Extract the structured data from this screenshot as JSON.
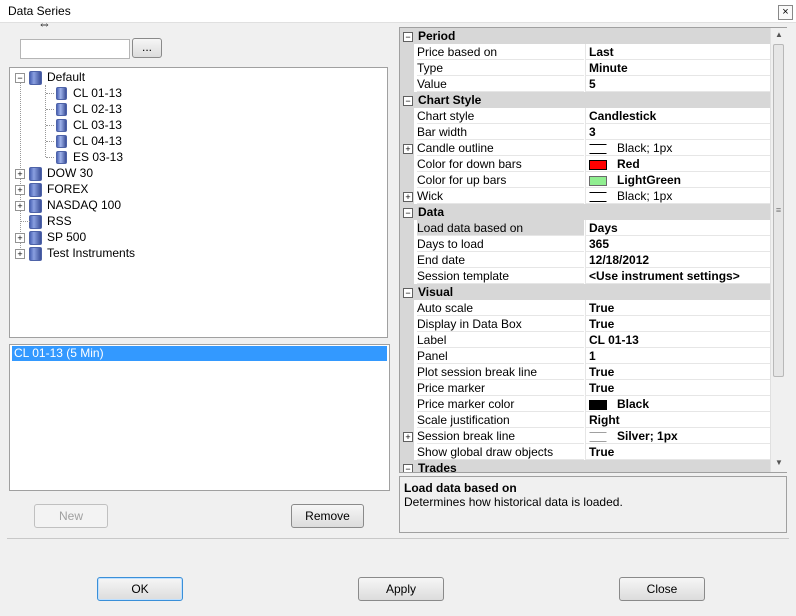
{
  "window": {
    "title": "Data Series",
    "close_glyph": "×"
  },
  "instrument_search": {
    "value": "",
    "browse_label": "..."
  },
  "tree": [
    {
      "label": "Default",
      "expander": "−"
    },
    {
      "label": "CL 01-13"
    },
    {
      "label": "CL 02-13"
    },
    {
      "label": "CL 03-13"
    },
    {
      "label": "CL 04-13"
    },
    {
      "label": "ES 03-13"
    },
    {
      "label": "DOW 30",
      "expander": "+"
    },
    {
      "label": "FOREX",
      "expander": "+"
    },
    {
      "label": "NASDAQ 100",
      "expander": "+"
    },
    {
      "label": "RSS"
    },
    {
      "label": "SP 500",
      "expander": "+"
    },
    {
      "label": "Test Instruments",
      "expander": "+"
    }
  ],
  "series_list": {
    "selected": "CL 01-13 (5 Min)"
  },
  "buttons": {
    "new": "New",
    "remove": "Remove",
    "ok": "OK",
    "apply": "Apply",
    "close": "Close"
  },
  "properties": {
    "period": {
      "title": "Period",
      "rows": [
        {
          "name": "Price based on",
          "value": "Last"
        },
        {
          "name": "Type",
          "value": "Minute"
        },
        {
          "name": "Value",
          "value": "5"
        }
      ]
    },
    "chart_style": {
      "title": "Chart Style",
      "rows": [
        {
          "name": "Chart style",
          "value": "Candlestick"
        },
        {
          "name": "Bar width",
          "value": "3"
        },
        {
          "name": "Candle outline",
          "value": "Black; 1px",
          "swatch_color": "#000000"
        },
        {
          "name": "Color for down bars",
          "value": "Red",
          "swatch_color": "#ff0000"
        },
        {
          "name": "Color for up bars",
          "value": "LightGreen",
          "swatch_color": "#90ee90"
        },
        {
          "name": "Wick",
          "value": "Black; 1px",
          "swatch_color": "#000000"
        }
      ]
    },
    "data": {
      "title": "Data",
      "rows": [
        {
          "name": "Load data based on",
          "value": "Days"
        },
        {
          "name": "Days to load",
          "value": "365"
        },
        {
          "name": "End date",
          "value": "12/18/2012"
        },
        {
          "name": "Session template",
          "value": "<Use instrument settings>"
        }
      ]
    },
    "visual": {
      "title": "Visual",
      "rows": [
        {
          "name": "Auto scale",
          "value": "True"
        },
        {
          "name": "Display in Data Box",
          "value": "True"
        },
        {
          "name": "Label",
          "value": "CL 01-13"
        },
        {
          "name": "Panel",
          "value": "1"
        },
        {
          "name": "Plot session break line",
          "value": "True"
        },
        {
          "name": "Price marker",
          "value": "True"
        },
        {
          "name": "Price marker color",
          "value": "Black",
          "swatch_color": "#000000"
        },
        {
          "name": "Scale justification",
          "value": "Right"
        },
        {
          "name": "Session break line",
          "value": "Silver; 1px",
          "swatch_color": "#c0c0c0"
        },
        {
          "name": "Show global draw objects",
          "value": "True"
        }
      ]
    },
    "trades": {
      "title": "Trades"
    }
  },
  "help": {
    "title": "Load data based on",
    "description": "Determines how historical data is loaded."
  },
  "glyphs": {
    "plus": "+",
    "minus": "−",
    "up": "▲",
    "down": "▼",
    "grip": "≡",
    "resize": "⇔"
  },
  "colors": {
    "selection": "#3399ff",
    "category_bg": "#d7d7d7"
  }
}
